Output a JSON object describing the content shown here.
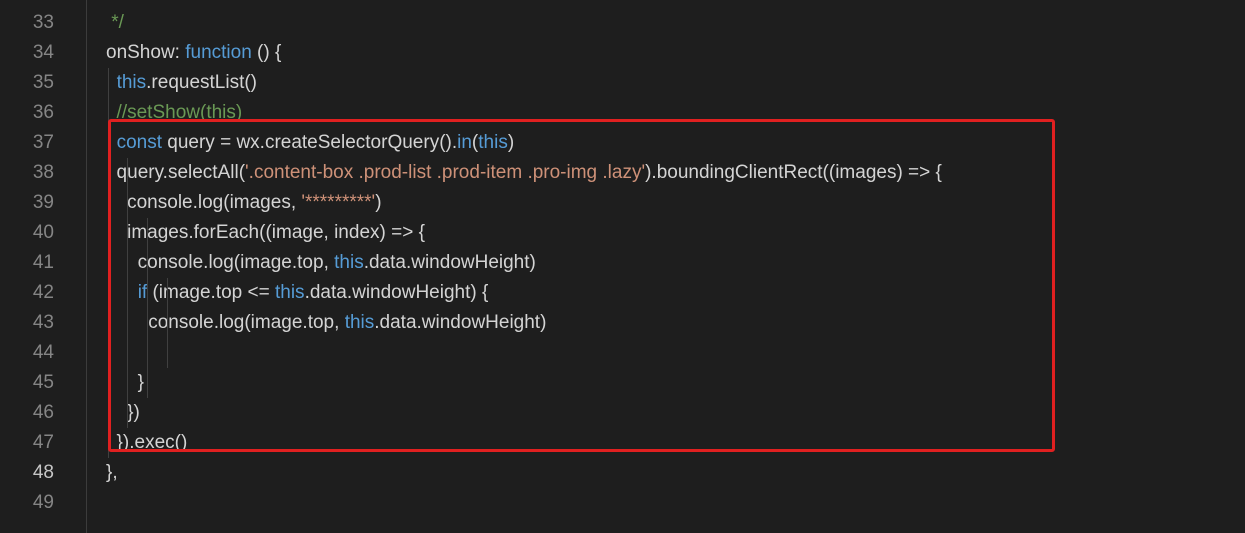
{
  "editor": {
    "highlight_color": "#e02020",
    "colors": {
      "background": "#1e1e1e",
      "keyword": "#569cd6",
      "string": "#ce9178",
      "comment": "#6a9955",
      "text": "#d4d4d4"
    },
    "lines": [
      {
        "num": "33",
        "segments": [
          {
            "t": " */",
            "c": "cm"
          }
        ]
      },
      {
        "num": "34",
        "segments": [
          {
            "t": "onShow: ",
            "c": ""
          },
          {
            "t": "function",
            "c": "kw"
          },
          {
            "t": " () {",
            "c": ""
          }
        ]
      },
      {
        "num": "35",
        "segments": [
          {
            "t": "  ",
            "c": ""
          },
          {
            "t": "this",
            "c": "kw"
          },
          {
            "t": ".requestList()",
            "c": ""
          }
        ]
      },
      {
        "num": "36",
        "segments": [
          {
            "t": "  //setShow(this)",
            "c": "cm"
          }
        ]
      },
      {
        "num": "37",
        "segments": [
          {
            "t": "  ",
            "c": ""
          },
          {
            "t": "const",
            "c": "kw"
          },
          {
            "t": " query = wx.createSelectorQuery().",
            "c": ""
          },
          {
            "t": "in",
            "c": "kw"
          },
          {
            "t": "(",
            "c": ""
          },
          {
            "t": "this",
            "c": "kw"
          },
          {
            "t": ")",
            "c": ""
          }
        ]
      },
      {
        "num": "38",
        "segments": [
          {
            "t": "  query.selectAll(",
            "c": ""
          },
          {
            "t": "'.content-box .prod-list .prod-item .pro-img .lazy'",
            "c": "str"
          },
          {
            "t": ").boundingClientRect((images) => {",
            "c": ""
          }
        ]
      },
      {
        "num": "39",
        "segments": [
          {
            "t": "    console.log(images, ",
            "c": ""
          },
          {
            "t": "'*********'",
            "c": "str"
          },
          {
            "t": ")",
            "c": ""
          }
        ]
      },
      {
        "num": "40",
        "segments": [
          {
            "t": "    images.forEach((image, index) => {",
            "c": ""
          }
        ]
      },
      {
        "num": "41",
        "segments": [
          {
            "t": "      console.log(image.top, ",
            "c": ""
          },
          {
            "t": "this",
            "c": "kw"
          },
          {
            "t": ".data.windowHeight)",
            "c": ""
          }
        ]
      },
      {
        "num": "42",
        "segments": [
          {
            "t": "      ",
            "c": ""
          },
          {
            "t": "if",
            "c": "kw"
          },
          {
            "t": " (image.top <= ",
            "c": ""
          },
          {
            "t": "this",
            "c": "kw"
          },
          {
            "t": ".data.windowHeight) {",
            "c": ""
          }
        ]
      },
      {
        "num": "43",
        "segments": [
          {
            "t": "        console.log(image.top, ",
            "c": ""
          },
          {
            "t": "this",
            "c": "kw"
          },
          {
            "t": ".data.windowHeight)",
            "c": ""
          }
        ]
      },
      {
        "num": "44",
        "segments": []
      },
      {
        "num": "45",
        "segments": [
          {
            "t": "      }",
            "c": ""
          }
        ]
      },
      {
        "num": "46",
        "segments": [
          {
            "t": "    })",
            "c": ""
          }
        ]
      },
      {
        "num": "47",
        "segments": [
          {
            "t": "  }).exec()",
            "c": ""
          }
        ]
      },
      {
        "num": "48",
        "active": true,
        "segments": [
          {
            "t": "},",
            "c": ""
          }
        ]
      },
      {
        "num": "49",
        "segments": []
      }
    ]
  }
}
